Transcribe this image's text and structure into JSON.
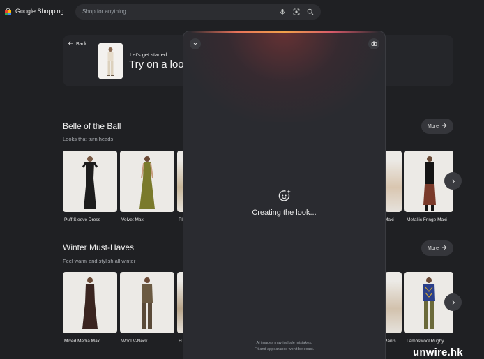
{
  "header": {
    "brand": "Google Shopping",
    "search_placeholder": "Shop for anything",
    "icons": [
      "mic-icon",
      "lens-icon",
      "search-icon"
    ]
  },
  "hero": {
    "back_label": "Back",
    "small_text": "Let's get started",
    "big_text": "Try on a loo"
  },
  "sections": [
    {
      "title": "Belle of the Ball",
      "subtitle": "Looks that turn heads",
      "more_label": "More",
      "items": [
        {
          "label": "Puff Sleeve Dress",
          "color": "#1c1c1c"
        },
        {
          "label": "Velvet Maxi",
          "color": "#7a7a2c"
        },
        {
          "label": "Pl",
          "color": "#c8b79a"
        },
        {
          "label": "Maxi",
          "color": "#d9c6b0"
        },
        {
          "label": "Metallic Fringe Maxi",
          "color": "#141414"
        }
      ]
    },
    {
      "title": "Winter Must-Haves",
      "subtitle": "Feel warm and stylish all winter",
      "more_label": "More",
      "items": [
        {
          "label": "Mixed Media Maxi",
          "color": "#3a2520"
        },
        {
          "label": "Wool V-Neck",
          "color": "#6b5a42"
        },
        {
          "label": "H",
          "color": "#b8a58a"
        },
        {
          "label": "Pants",
          "color": "#d2c2ad"
        },
        {
          "label": "Lambswool Rugby",
          "color": "#2a3f8a"
        }
      ]
    }
  ],
  "panel": {
    "loading_text": "Creating the look...",
    "disclaimer_line1": "AI images may include mistakes.",
    "disclaimer_line2": "Fit and appearance won't be exact."
  },
  "watermark": "unwire.hk",
  "colors": {
    "background": "#1f2023",
    "panel": "#2a2b30",
    "accent_glow": "#e8735a"
  }
}
